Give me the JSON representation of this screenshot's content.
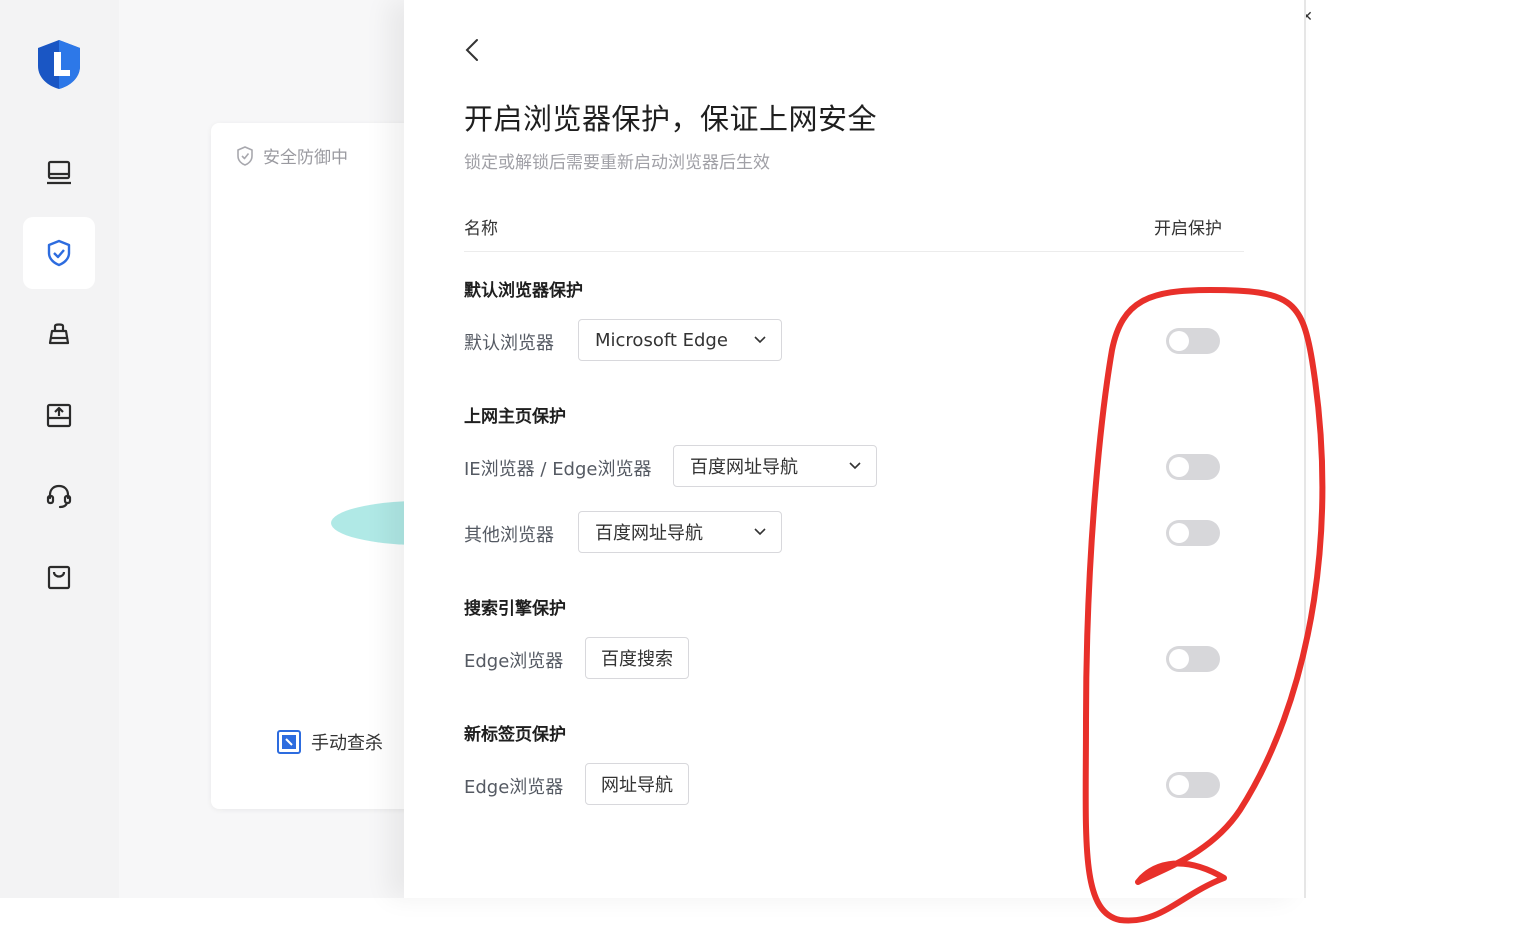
{
  "sidebar": {
    "items": [
      {
        "name": "computer-icon"
      },
      {
        "name": "shield-check-icon",
        "active": true
      },
      {
        "name": "cleaner-icon"
      },
      {
        "name": "upload-box-icon"
      },
      {
        "name": "headset-icon"
      },
      {
        "name": "shopping-bag-icon"
      }
    ],
    "accent_color": "#2d6cdf"
  },
  "background_card": {
    "status_text": "安全防御中",
    "manual_scan_label": "手动查杀"
  },
  "panel": {
    "title": "开启浏览器保护，保证上网安全",
    "subtitle": "锁定或解锁后需要重新启动浏览器后生效",
    "column_name": "名称",
    "column_protect": "开启保护",
    "sections": [
      {
        "title": "默认浏览器保护",
        "rows": [
          {
            "label": "默认浏览器",
            "control": "dropdown",
            "value": "Microsoft Edge",
            "enabled": false
          }
        ]
      },
      {
        "title": "上网主页保护",
        "rows": [
          {
            "label": "IE浏览器 / Edge浏览器",
            "control": "dropdown",
            "value": "百度网址导航",
            "enabled": false
          },
          {
            "label": "其他浏览器",
            "control": "dropdown",
            "value": "百度网址导航",
            "enabled": false
          }
        ]
      },
      {
        "title": "搜索引擎保护",
        "rows": [
          {
            "label": "Edge浏览器",
            "control": "tag",
            "value": "百度搜索",
            "enabled": false
          }
        ]
      },
      {
        "title": "新标签页保护",
        "rows": [
          {
            "label": "Edge浏览器",
            "control": "tag",
            "value": "网址导航",
            "enabled": false
          }
        ]
      }
    ]
  },
  "colors": {
    "toggle_off": "#d7d7da",
    "annotation": "#e8302a"
  }
}
